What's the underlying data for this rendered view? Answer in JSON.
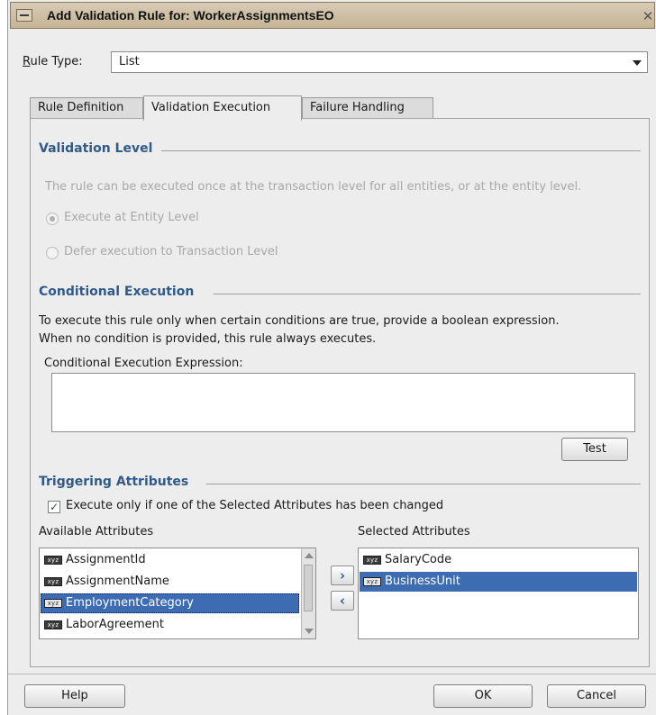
{
  "window": {
    "title": "Add Validation Rule for: WorkerAssignmentsEO"
  },
  "rule_type": {
    "label": "Rule Type:",
    "value": "List"
  },
  "tabs": [
    {
      "label": "Rule Definition"
    },
    {
      "label": "Validation Execution",
      "active": true
    },
    {
      "label": "Failure Handling"
    }
  ],
  "validation_level": {
    "heading": "Validation Level",
    "description": "The rule can be executed once at the transaction level for all entities, or at the entity level.",
    "options": [
      {
        "label": "Execute at Entity Level",
        "selected": true
      },
      {
        "label": "Defer execution to Transaction Level",
        "selected": false
      }
    ]
  },
  "conditional_execution": {
    "heading": "Conditional Execution",
    "description_line1": "To execute this rule only when certain conditions are true, provide a boolean expression.",
    "description_line2": "When no condition is provided, this rule always executes.",
    "expression_label": "Conditional Execution Expression:",
    "expression_value": "",
    "test_button": "Test"
  },
  "triggering_attributes": {
    "heading": "Triggering Attributes",
    "checkbox_label": "Execute only if one of the Selected Attributes has been changed",
    "checkbox_checked": true,
    "available_label": "Available Attributes",
    "selected_label": "Selected Attributes",
    "available": [
      {
        "name": "AssignmentId",
        "selected": false
      },
      {
        "name": "AssignmentName",
        "selected": false
      },
      {
        "name": "EmploymentCategory",
        "selected": true
      },
      {
        "name": "LaborAgreement",
        "selected": false
      }
    ],
    "selected": [
      {
        "name": "SalaryCode",
        "selected": false
      },
      {
        "name": "BusinessUnit",
        "selected": true
      }
    ],
    "attr_icon_text": "xyz"
  },
  "buttons": {
    "help": "Help",
    "ok": "OK",
    "cancel": "Cancel"
  },
  "colors": {
    "section_heading": "#2f5a8a",
    "selection": "#3e6cb2",
    "titlebar": "#c8b89c"
  }
}
